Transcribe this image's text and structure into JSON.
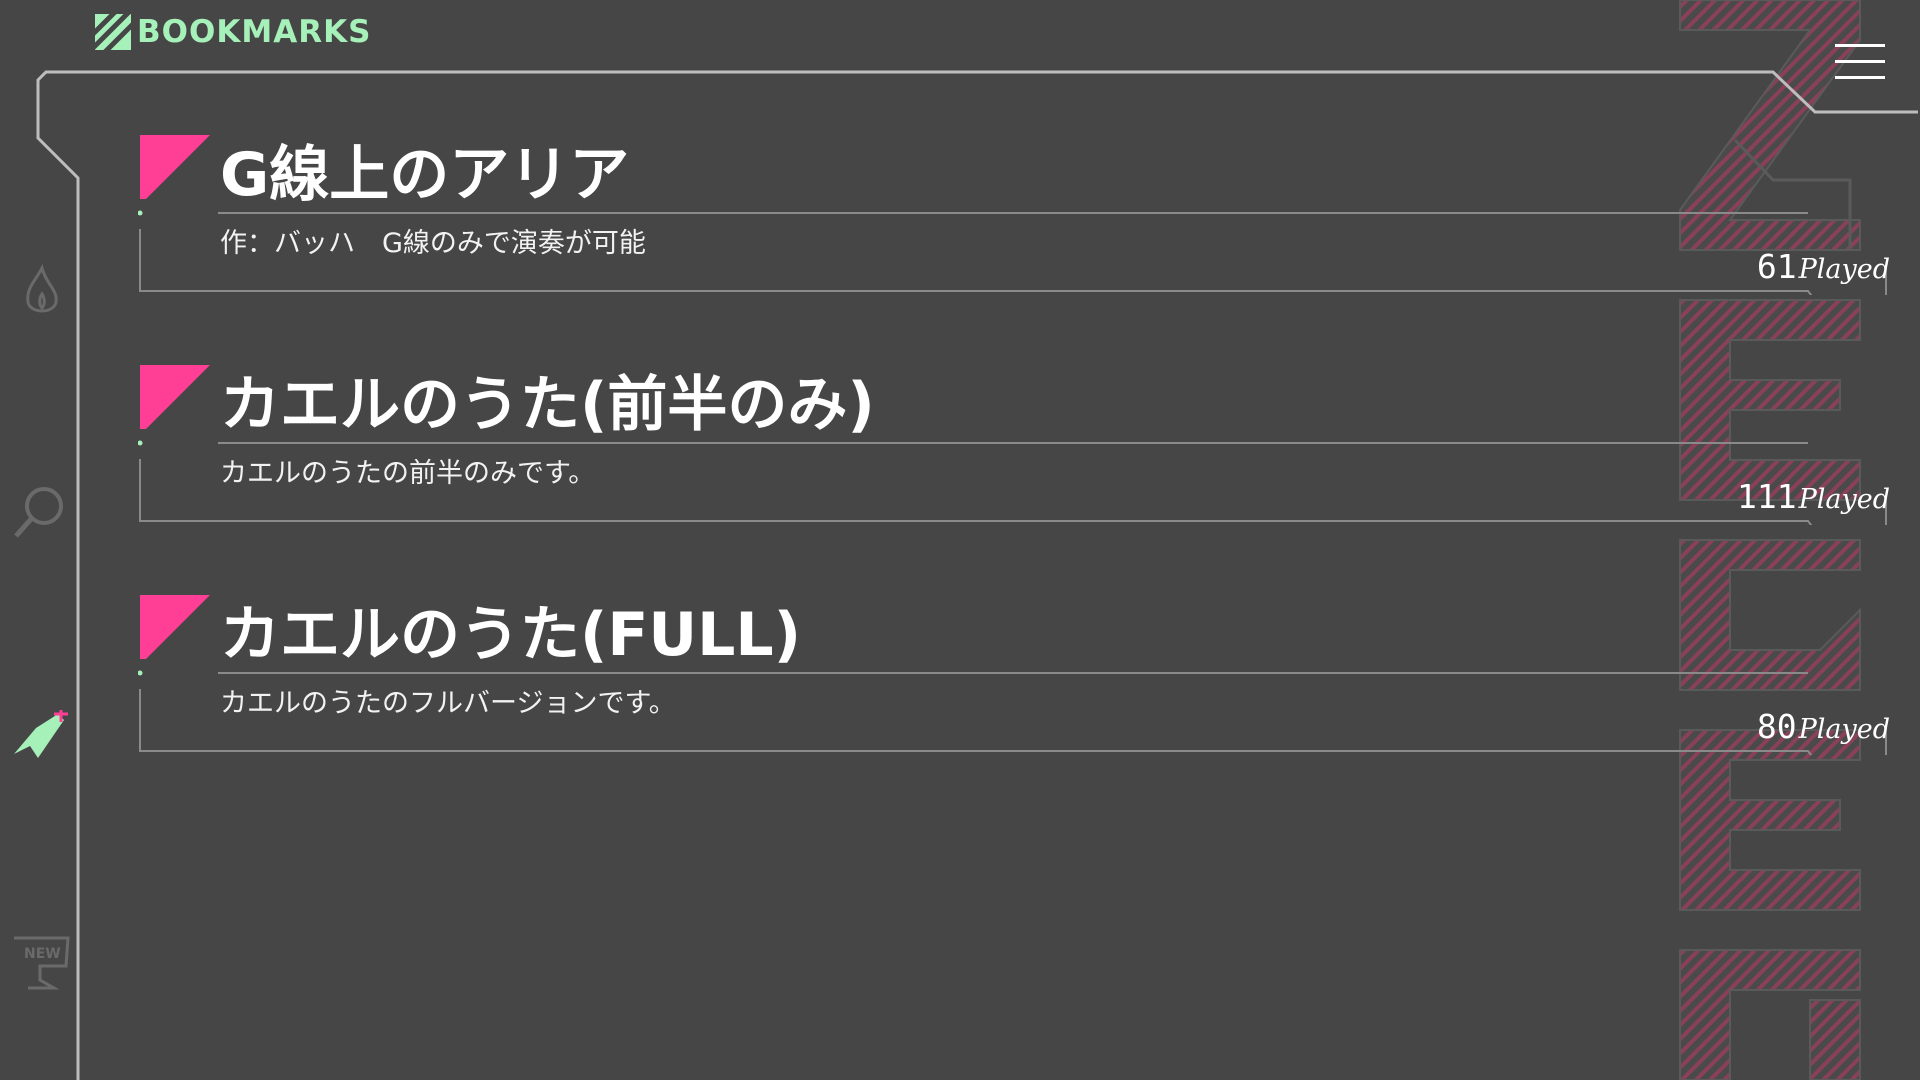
{
  "header": {
    "logo_text": "BOOKMARKS",
    "logo_icon": "striped-logo-icon",
    "menu_icon": "hamburger-menu-icon"
  },
  "sidebar": {
    "items": [
      {
        "icon": "flame-icon",
        "active": false
      },
      {
        "icon": "search-icon",
        "active": false
      },
      {
        "icon": "bookmark-icon",
        "active": true
      },
      {
        "icon": "new-icon",
        "label": "NEW",
        "active": false
      }
    ]
  },
  "songs": [
    {
      "title": "G線上のアリア",
      "description": "作：バッハ　G線のみで演奏が可能",
      "played_count": "61",
      "played_label": "Played"
    },
    {
      "title": "カエルのうた(前半のみ)",
      "description": "カエルのうたの前半のみです。",
      "played_count": "111",
      "played_label": "Played"
    },
    {
      "title": "カエルのうた(FULL)",
      "description": "カエルのうたのフルバージョンです。",
      "played_count": "80",
      "played_label": "Played"
    }
  ],
  "colors": {
    "background": "#464646",
    "accent_pink": "#ff3f95",
    "accent_green": "#a6f0b9",
    "line": "#bdbdbd"
  }
}
